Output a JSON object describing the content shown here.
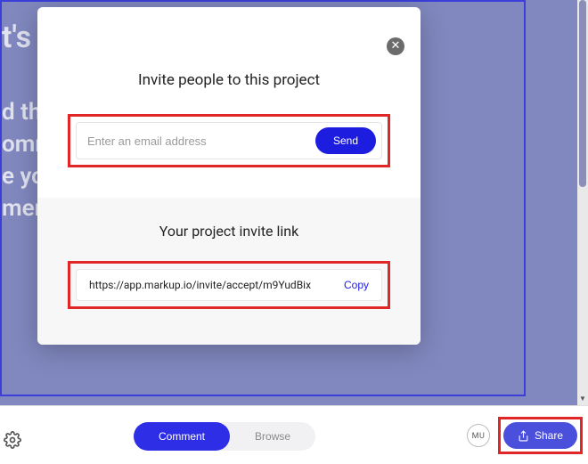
{
  "background": {
    "line1": "t's",
    "line2": "d th",
    "line3": "omr",
    "line4": "e yo",
    "line5": "mer"
  },
  "modal": {
    "title": "Invite people to this project",
    "email_placeholder": "Enter an email address",
    "send_label": "Send",
    "link_title": "Your project invite link",
    "invite_link": "https://app.markup.io/invite/accept/m9YudBix",
    "copy_label": "Copy"
  },
  "bottombar": {
    "comment_label": "Comment",
    "browse_label": "Browse",
    "avatar_initials": "MU",
    "share_label": "Share"
  },
  "highlight_color": "#e02626"
}
